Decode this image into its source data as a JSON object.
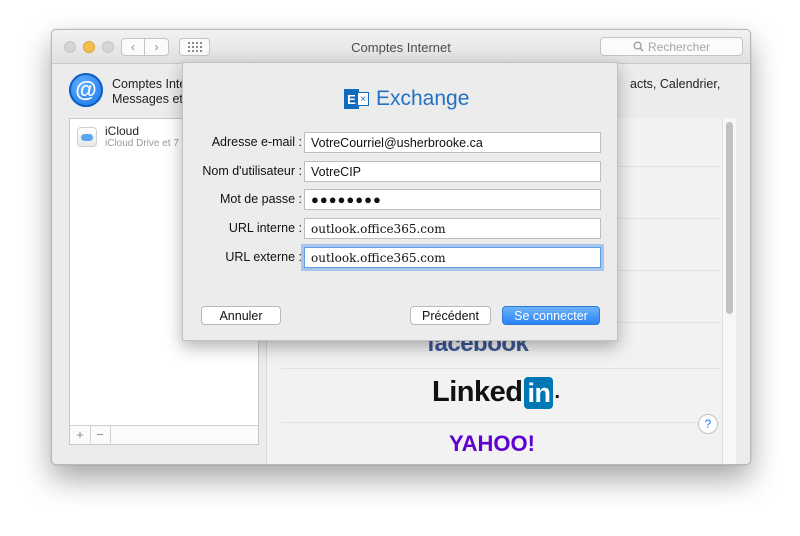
{
  "window": {
    "title": "Comptes Internet",
    "search_placeholder": "Rechercher",
    "nav_back": "‹",
    "nav_forward": "›"
  },
  "intro": {
    "line1": "Comptes Inte",
    "line2": "Messages et",
    "line1_right": "acts, Calendrier,"
  },
  "sidebar": {
    "items": [
      {
        "name": "iCloud",
        "subtitle": "iCloud Drive et 7"
      }
    ],
    "add_label": "+",
    "remove_label": "−"
  },
  "providers": {
    "facebook": "facebook",
    "linkedin_word": "Linked",
    "linkedin_badge": "in",
    "linkedin_dot": ".",
    "yahoo": "YAHOO!"
  },
  "help_label": "?",
  "sheet": {
    "logo_text": "Exchange",
    "logo_letter": "E",
    "fields": [
      {
        "label": "Adresse e-mail :",
        "value": "VotreCourriel@usherbrooke.ca"
      },
      {
        "label": "Nom d'utilisateur :",
        "value": "VotreCIP"
      },
      {
        "label": "Mot de passe :",
        "value": "●●●●●●●●"
      },
      {
        "label": "URL interne :",
        "value": "outlook.office365.com"
      },
      {
        "label": "URL externe :",
        "value": "outlook.office365.com"
      }
    ],
    "cancel_label": "Annuler",
    "previous_label": "Précédent",
    "connect_label": "Se connecter"
  },
  "colors": {
    "accent": "#2a83f3",
    "exchange_blue": "#0f6cbd",
    "facebook_blue": "#3b5998",
    "linkedin_blue": "#0077b5",
    "yahoo_purple": "#5f01d1"
  }
}
